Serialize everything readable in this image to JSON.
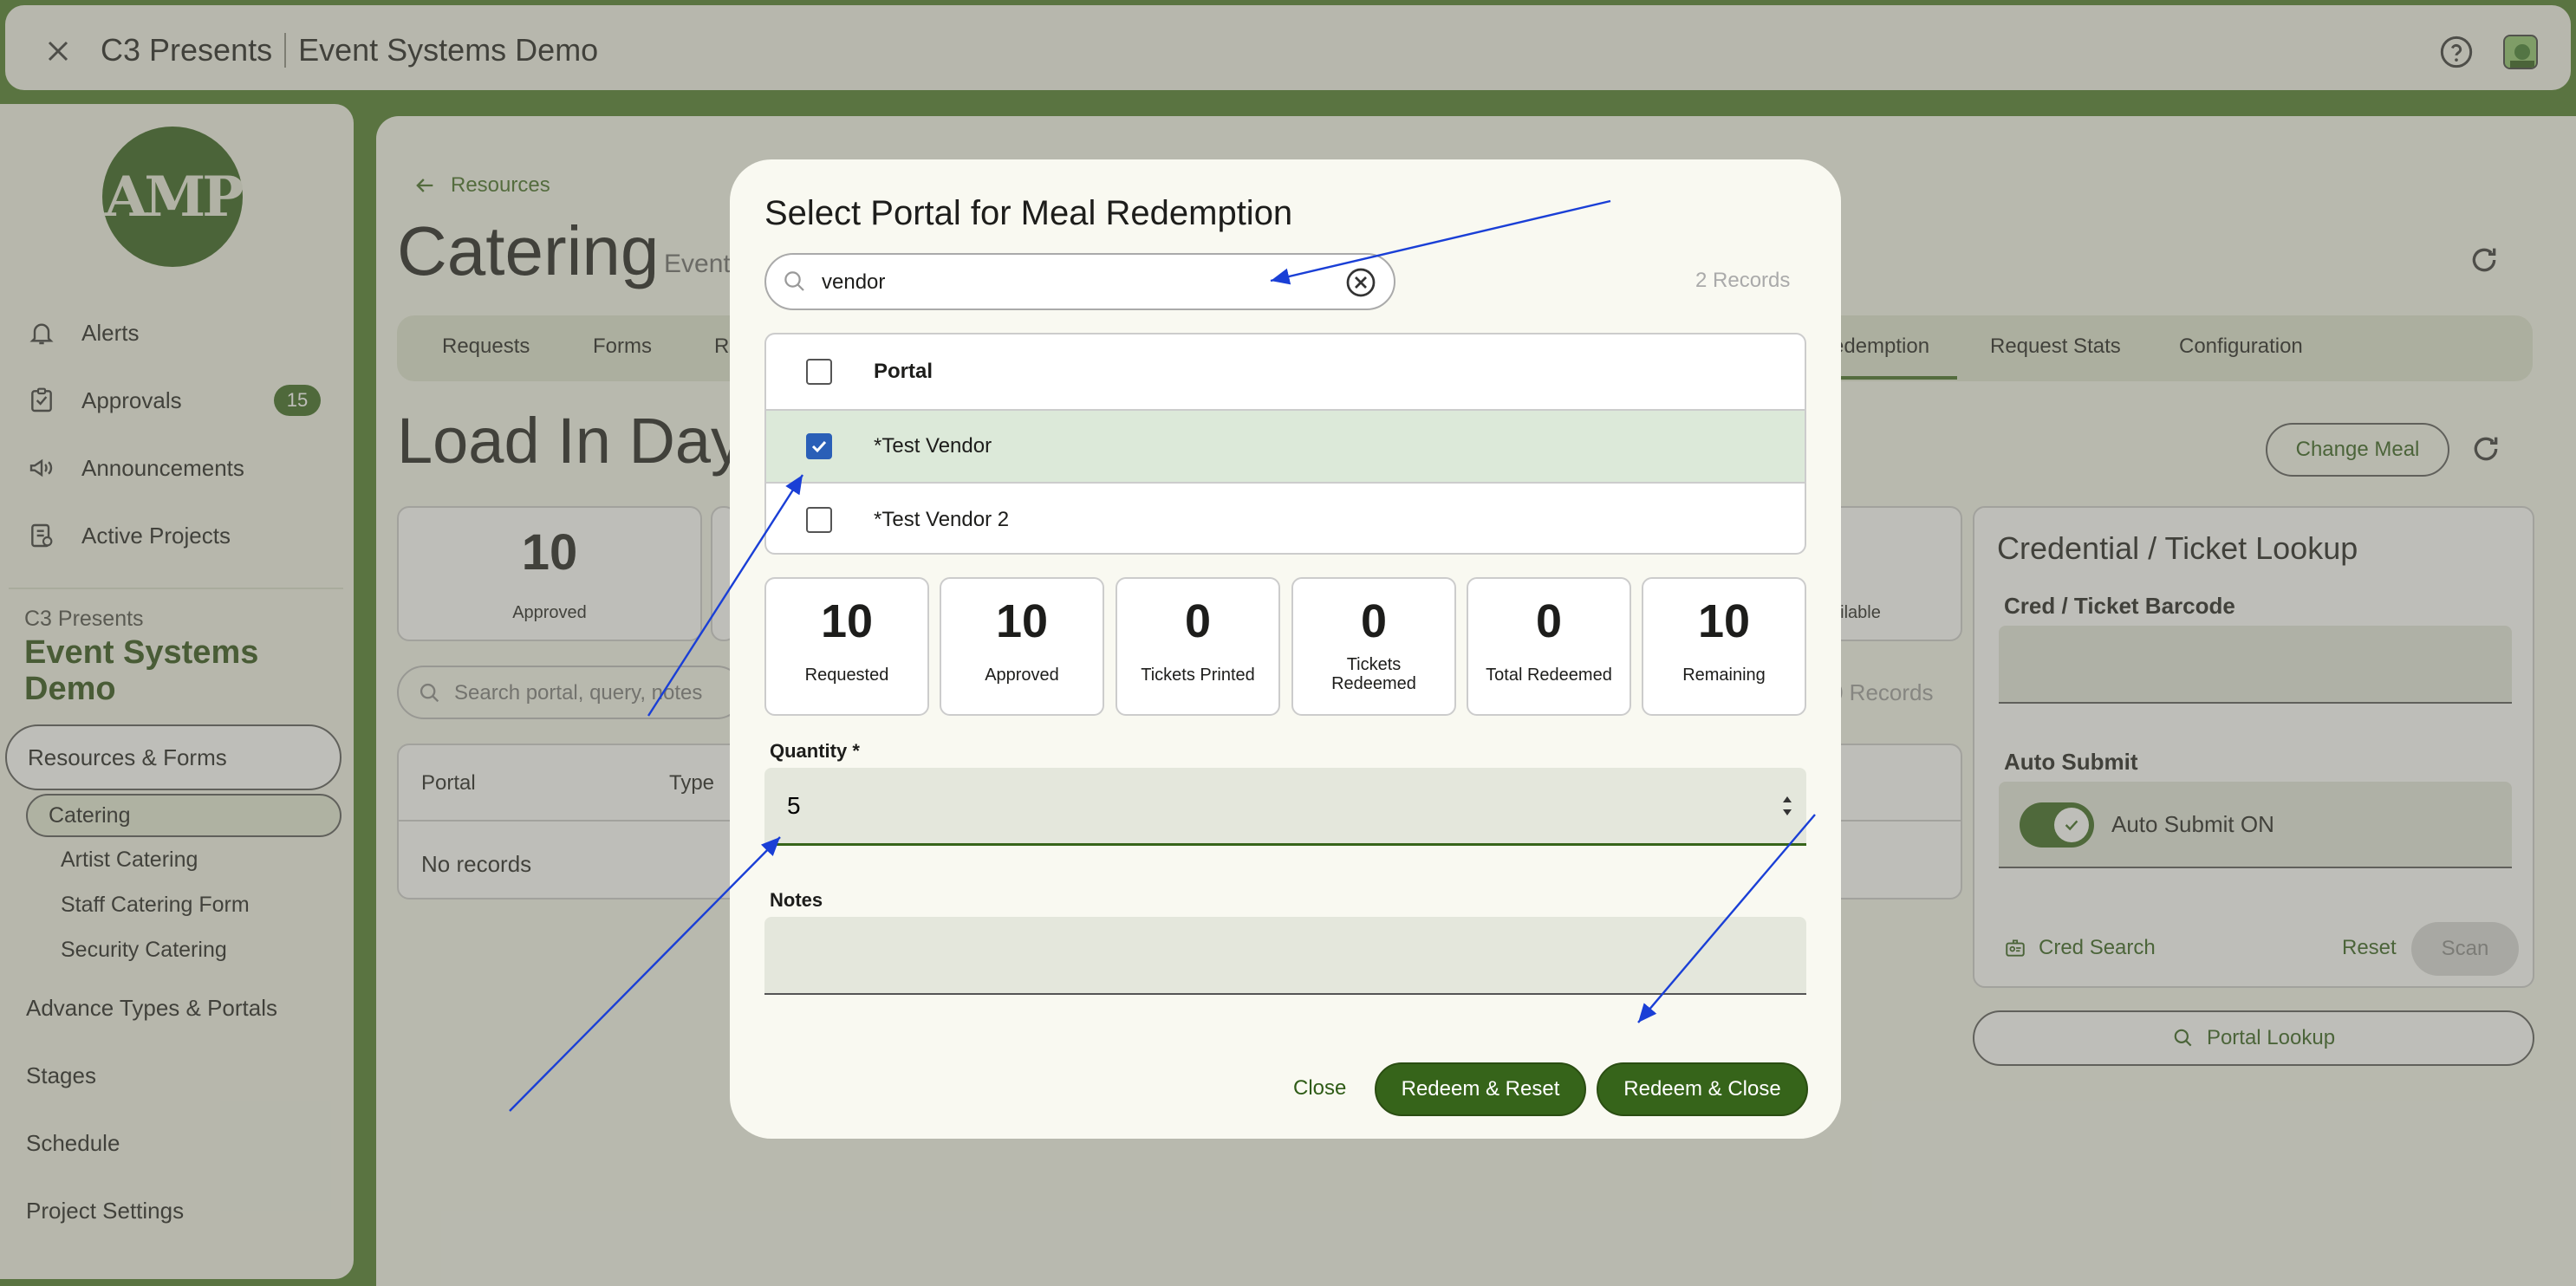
{
  "topbar": {
    "org": "C3 Presents",
    "project": "Event Systems Demo"
  },
  "sidebar": {
    "logo_text": "AMP",
    "items": [
      {
        "label": "Alerts",
        "icon": "bell-icon"
      },
      {
        "label": "Approvals",
        "icon": "checklist-icon",
        "badge": "15"
      },
      {
        "label": "Announcements",
        "icon": "megaphone-icon"
      },
      {
        "label": "Active Projects",
        "icon": "project-icon"
      }
    ],
    "project_org": "C3 Presents",
    "project_name": "Event Systems Demo",
    "group_label": "Resources & Forms",
    "active_sub": "Catering",
    "subs": [
      "Artist Catering",
      "Staff Catering Form",
      "Security Catering"
    ],
    "links": [
      "Advance Types & Portals",
      "Stages",
      "Schedule",
      "Project Settings"
    ]
  },
  "main": {
    "back_label": "Resources",
    "title": "Catering",
    "subtitle": "Event",
    "tabs": [
      "Requests",
      "Forms",
      "Re",
      "edemption",
      "Request Stats",
      "Configuration"
    ],
    "section_title": "Load In Day",
    "change_meal": "Change Meal",
    "stat_approved_value": "10",
    "stat_approved_label": "Approved",
    "stat_available_label": "vailable",
    "search_placeholder": "Search portal, query, notes",
    "records_label": "0 Records",
    "table_cols": [
      "Portal",
      "Type"
    ],
    "no_records": "No records"
  },
  "cred": {
    "title": "Credential / Ticket Lookup",
    "barcode_label": "Cred / Ticket Barcode",
    "auto_label": "Auto Submit",
    "auto_toggle_label": "Auto Submit ON",
    "cred_search": "Cred Search",
    "reset": "Reset",
    "scan": "Scan",
    "portal_lookup": "Portal Lookup"
  },
  "modal": {
    "title": "Select Portal for Meal Redemption",
    "search_value": "vendor",
    "records": "2 Records",
    "header": "Portal",
    "rows": [
      {
        "label": "*Test Vendor",
        "checked": true
      },
      {
        "label": "*Test Vendor 2",
        "checked": false
      }
    ],
    "stats": [
      {
        "value": "10",
        "label": "Requested"
      },
      {
        "value": "10",
        "label": "Approved"
      },
      {
        "value": "0",
        "label": "Tickets Printed"
      },
      {
        "value": "0",
        "label": "Tickets Redeemed"
      },
      {
        "value": "0",
        "label": "Total Redeemed"
      },
      {
        "value": "10",
        "label": "Remaining"
      }
    ],
    "quantity_label": "Quantity *",
    "quantity_value": "5",
    "notes_label": "Notes",
    "close": "Close",
    "redeem_reset": "Redeem & Reset",
    "redeem_close": "Redeem & Close"
  },
  "colors": {
    "brand_green": "#36641a",
    "annotation_blue": "#1a3fd6",
    "checkbox_blue": "#2a5fb7"
  }
}
